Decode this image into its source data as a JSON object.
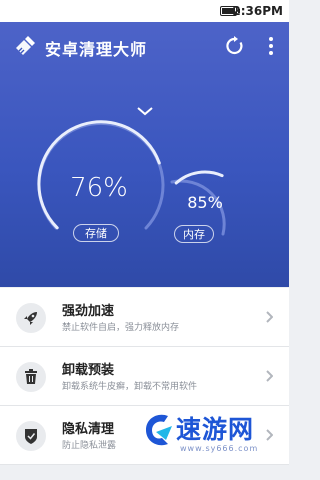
{
  "status_bar": {
    "time": "2:36PM"
  },
  "app": {
    "title": "安卓清理大师"
  },
  "icons": {
    "app": "broom-icon",
    "refresh": "refresh-icon",
    "more": "more-vertical-icon",
    "expand": "chevron-down-icon"
  },
  "storage": {
    "percent": 76,
    "label": "76%",
    "button": "存储"
  },
  "memory": {
    "percent": 85,
    "label": "85%",
    "button": "内存"
  },
  "menu": [
    {
      "title": "强劲加速",
      "subtitle": "禁止软件自启，强力释放内存",
      "icon": "rocket-icon"
    },
    {
      "title": "卸载预装",
      "subtitle": "卸载系统牛皮癣，卸载不常用软件",
      "icon": "trash-icon"
    },
    {
      "title": "隐私清理",
      "subtitle": "防止隐私泄露",
      "icon": "shield-icon"
    }
  ],
  "watermark": {
    "brand": "速游网",
    "url": "www.sy666.com"
  },
  "colors": {
    "hero": "#3a56be",
    "accent": "#1e56d6",
    "ring_track": "#6e84d6"
  }
}
